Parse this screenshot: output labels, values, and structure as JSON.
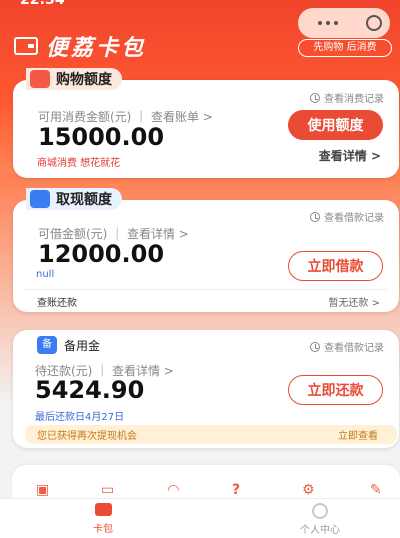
{
  "status_time": "22:34",
  "brand": {
    "title": "便荔卡包",
    "slogan": "先购物 后消费"
  },
  "shopping": {
    "tag": "购物额度",
    "record": "查看消费记录",
    "meta": "可用消费金额(元) ｜ 查看账单 >",
    "amount": "15000.00",
    "sub": "商城消费 想花就花",
    "button": "使用额度",
    "detail": "查看详情 >"
  },
  "cash": {
    "tag": "取现额度",
    "record": "查看借款记录",
    "meta": "可借金额(元) ｜ 查看详情 >",
    "amount": "12000.00",
    "sub": "null",
    "button": "立即借款",
    "repay_left": "查账还款",
    "repay_right": "暂无还款 >"
  },
  "reserve": {
    "icon": "备",
    "title": "备用金",
    "record": "查看借款记录",
    "meta": "待还款(元) ｜ 查看详情 >",
    "amount": "5424.90",
    "last_repay": "最后还款日4月27日",
    "button": "立即还款",
    "notice": "您已获得再次提现机会",
    "notice_action": "立即查看"
  },
  "services": [
    "cart-icon",
    "card-icon",
    "headset-icon",
    "question-icon",
    "gear-icon",
    "edit-icon"
  ],
  "nav": {
    "home": "卡包",
    "me": "个人中心"
  },
  "colors": {
    "accent": "#e94b35",
    "blue": "#3b7cf1",
    "notice": "#c77a17"
  }
}
